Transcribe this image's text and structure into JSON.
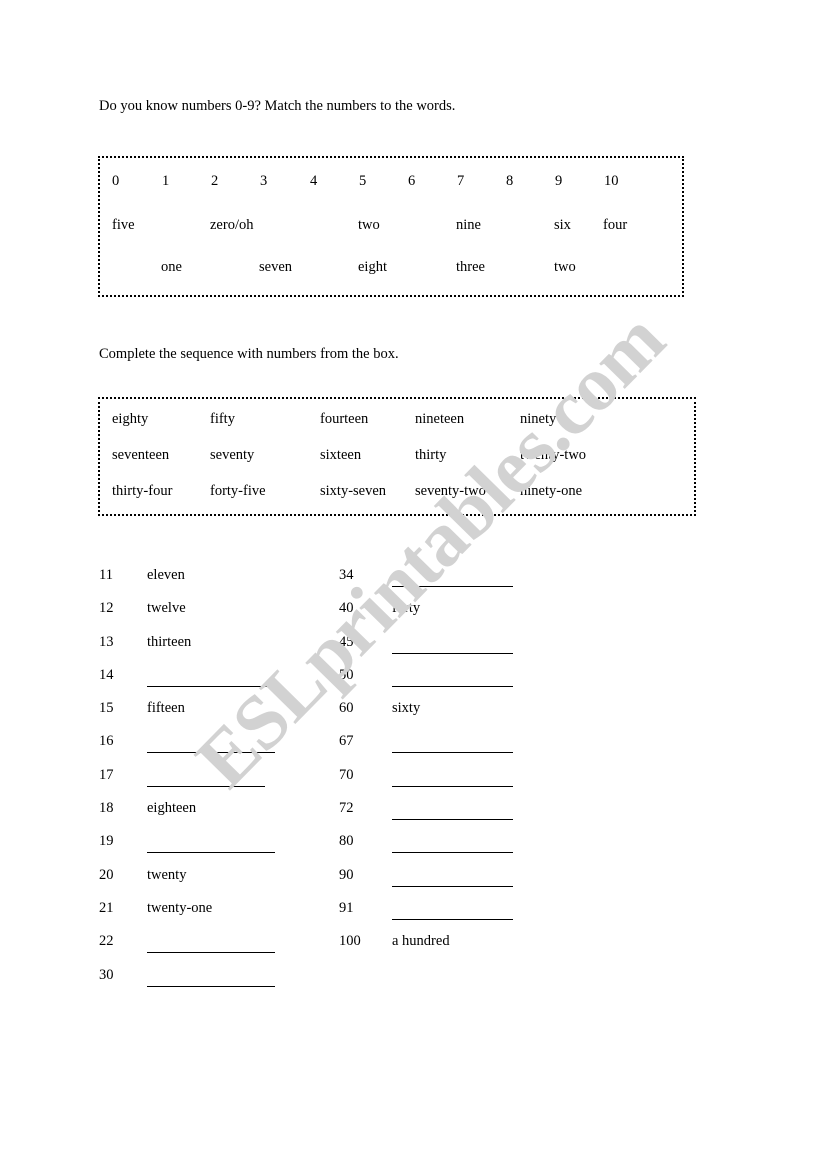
{
  "worksheet": {
    "watermark": "ESLprintables.com",
    "instruction_1": "Do you know numbers 0-9? Match the numbers to the words.",
    "instruction_2": "Complete the sequence with numbers from the box."
  },
  "number_box": {
    "digits": [
      "0",
      "1",
      "2",
      "3",
      "4",
      "5",
      "6",
      "7",
      "8",
      "9",
      "10"
    ],
    "words_row_1": [
      "five",
      "zero/oh",
      "two",
      "nine",
      "six",
      "four"
    ],
    "words_row_2": [
      "one",
      "seven",
      "eight",
      "three",
      "two"
    ]
  },
  "word_bank": {
    "rows": [
      [
        "eighty",
        "fifty",
        "fourteen",
        "nineteen",
        "ninety"
      ],
      [
        "seventeen",
        "seventy",
        "sixteen",
        "thirty",
        "twenty-two"
      ],
      [
        "thirty-four",
        "forty-five",
        "sixty-seven",
        "seventy-two",
        "ninety-one"
      ]
    ]
  },
  "sequence": {
    "left_column": [
      {
        "number": "11",
        "word": "eleven",
        "blank": false
      },
      {
        "number": "12",
        "word": "twelve",
        "blank": false
      },
      {
        "number": "13",
        "word": "thirteen",
        "blank": false
      },
      {
        "number": "14",
        "word": "",
        "blank": true
      },
      {
        "number": "15",
        "word": "fifteen",
        "blank": false
      },
      {
        "number": "16",
        "word": "",
        "blank": true
      },
      {
        "number": "17",
        "word": "",
        "blank": true
      },
      {
        "number": "18",
        "word": "eighteen",
        "blank": false
      },
      {
        "number": "19",
        "word": "",
        "blank": true
      },
      {
        "number": "20",
        "word": "twenty",
        "blank": false
      },
      {
        "number": "21",
        "word": "twenty-one",
        "blank": false
      },
      {
        "number": "22",
        "word": "",
        "blank": true
      },
      {
        "number": "30",
        "word": "",
        "blank": true
      }
    ],
    "right_column": [
      {
        "number": "34",
        "word": "",
        "blank": true
      },
      {
        "number": "40",
        "word": "forty",
        "blank": false
      },
      {
        "number": "45",
        "word": "",
        "blank": true
      },
      {
        "number": "50",
        "word": "",
        "blank": true
      },
      {
        "number": "60",
        "word": "sixty",
        "blank": false
      },
      {
        "number": "67",
        "word": "",
        "blank": true
      },
      {
        "number": "70",
        "word": "",
        "blank": true
      },
      {
        "number": "72",
        "word": "",
        "blank": true
      },
      {
        "number": "80",
        "word": "",
        "blank": true
      },
      {
        "number": "90",
        "word": "",
        "blank": true
      },
      {
        "number": "91",
        "word": "",
        "blank": true
      },
      {
        "number": "100",
        "word": "a hundred",
        "blank": false
      }
    ]
  },
  "colors": {
    "text": "#000000",
    "watermark": "#d2d2d2",
    "page_background": "#ffffff",
    "border": "#000000"
  }
}
